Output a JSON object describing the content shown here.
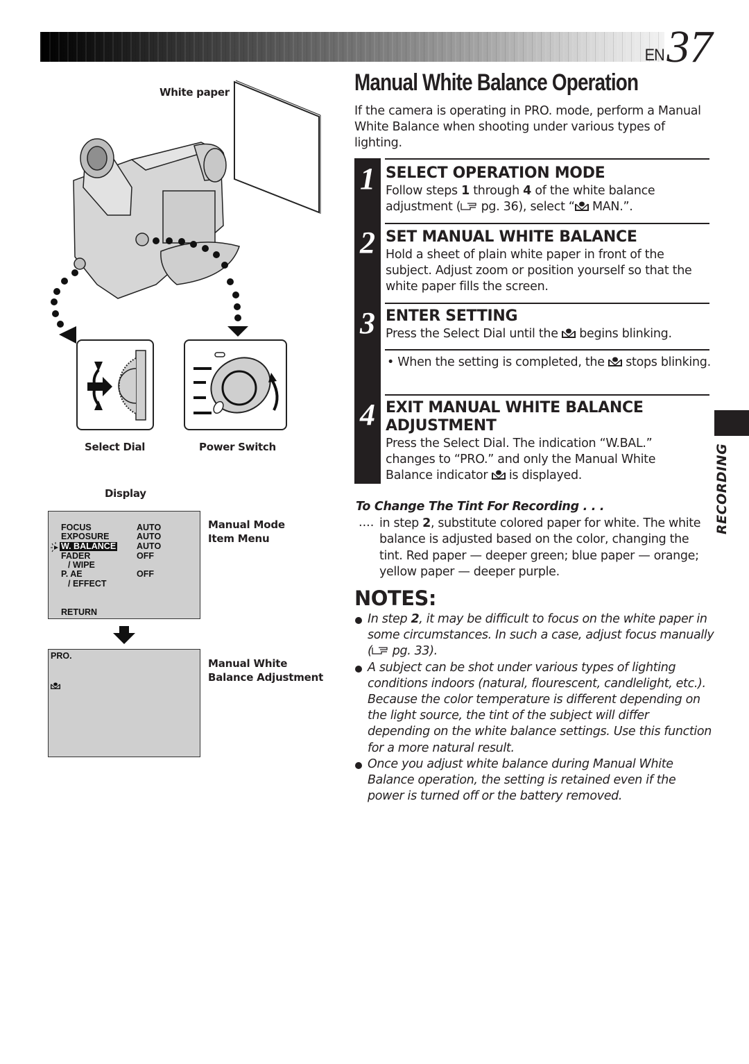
{
  "header": {
    "page_prefix": "EN",
    "page_number": "37"
  },
  "illustration": {
    "white_paper_label": "White paper",
    "select_dial_label": "Select Dial",
    "power_switch_label": "Power Switch",
    "display_label": "Display"
  },
  "osd_menu": {
    "rows": [
      {
        "item": "FOCUS",
        "value": "AUTO"
      },
      {
        "item": "EXPOSURE",
        "value": "AUTO"
      },
      {
        "item": "W. BALANCE",
        "value": "AUTO",
        "highlighted": true
      },
      {
        "item": "FADER",
        "value": "OFF"
      },
      {
        "item": "/ WIPE",
        "value": ""
      },
      {
        "item": "P. AE",
        "value": "OFF"
      },
      {
        "item": "/ EFFECT",
        "value": ""
      },
      {
        "item": "RETURN",
        "value": ""
      }
    ],
    "caption_line1": "Manual Mode",
    "caption_line2": "Item Menu"
  },
  "osd_pro": {
    "mode_text": "PRO.",
    "indicator_icon": "manual-white-balance-icon",
    "caption_line1": "Manual White",
    "caption_line2": "Balance Adjustment"
  },
  "main": {
    "title": "Manual White Balance Operation",
    "intro": "If the camera is operating in PRO. mode, perform a Manual White Balance when shooting under various types of lighting.",
    "steps": [
      {
        "number": "1",
        "title": "SELECT OPERATION MODE",
        "body_a": "Follow steps ",
        "body_b1": "1",
        "body_c": " through ",
        "body_b2": "4",
        "body_d": " of the white balance adjustment (",
        "body_e": " pg. 36), select “",
        "body_f": " MAN.”."
      },
      {
        "number": "2",
        "title": "SET MANUAL WHITE BALANCE",
        "body": "Hold a sheet of plain white paper in front of the subject. Adjust zoom or position yourself so that the white paper fills the screen."
      },
      {
        "number": "3",
        "title": "ENTER SETTING",
        "body_a": "Press the Select Dial until the ",
        "body_b": " begins blinking.",
        "note_a": "When the setting is completed, the ",
        "note_b": " stops blinking."
      },
      {
        "number": "4",
        "title_line1": "EXIT MANUAL WHITE BALANCE",
        "title_line2": "ADJUSTMENT",
        "body_a": "Press the Select Dial. The indication “W.BAL.” changes to “PRO.” and only the Manual White Balance indicator ",
        "body_b": " is displayed."
      }
    ],
    "tint": {
      "title": "To Change The Tint For Recording . . .",
      "lead": "....",
      "body_a": "in step ",
      "body_b": "2",
      "body_c": ", substitute colored paper for white. The white balance is adjusted based on the color, changing the tint. Red paper — deeper green; blue paper — orange; yellow paper — deeper purple."
    },
    "notes": {
      "title": "NOTES:",
      "items": [
        {
          "a": "In step ",
          "b": "2",
          "c": ", it may be difficult to focus on the white paper in some circumstances. In such a case, adjust focus manually (",
          "d": " pg. 33)."
        },
        {
          "a": "A subject can be shot under various types of lighting conditions indoors (natural, flourescent, candlelight, etc.). Because the color temperature is different depending on the light source, the tint of the subject will differ depending on the white balance settings. Use this function for a more natural result."
        },
        {
          "a": "Once you adjust white balance during Manual White Balance operation, the setting is retained even if the power is turned off or the battery removed."
        }
      ]
    }
  },
  "section_tab": {
    "label": "RECORDING"
  }
}
